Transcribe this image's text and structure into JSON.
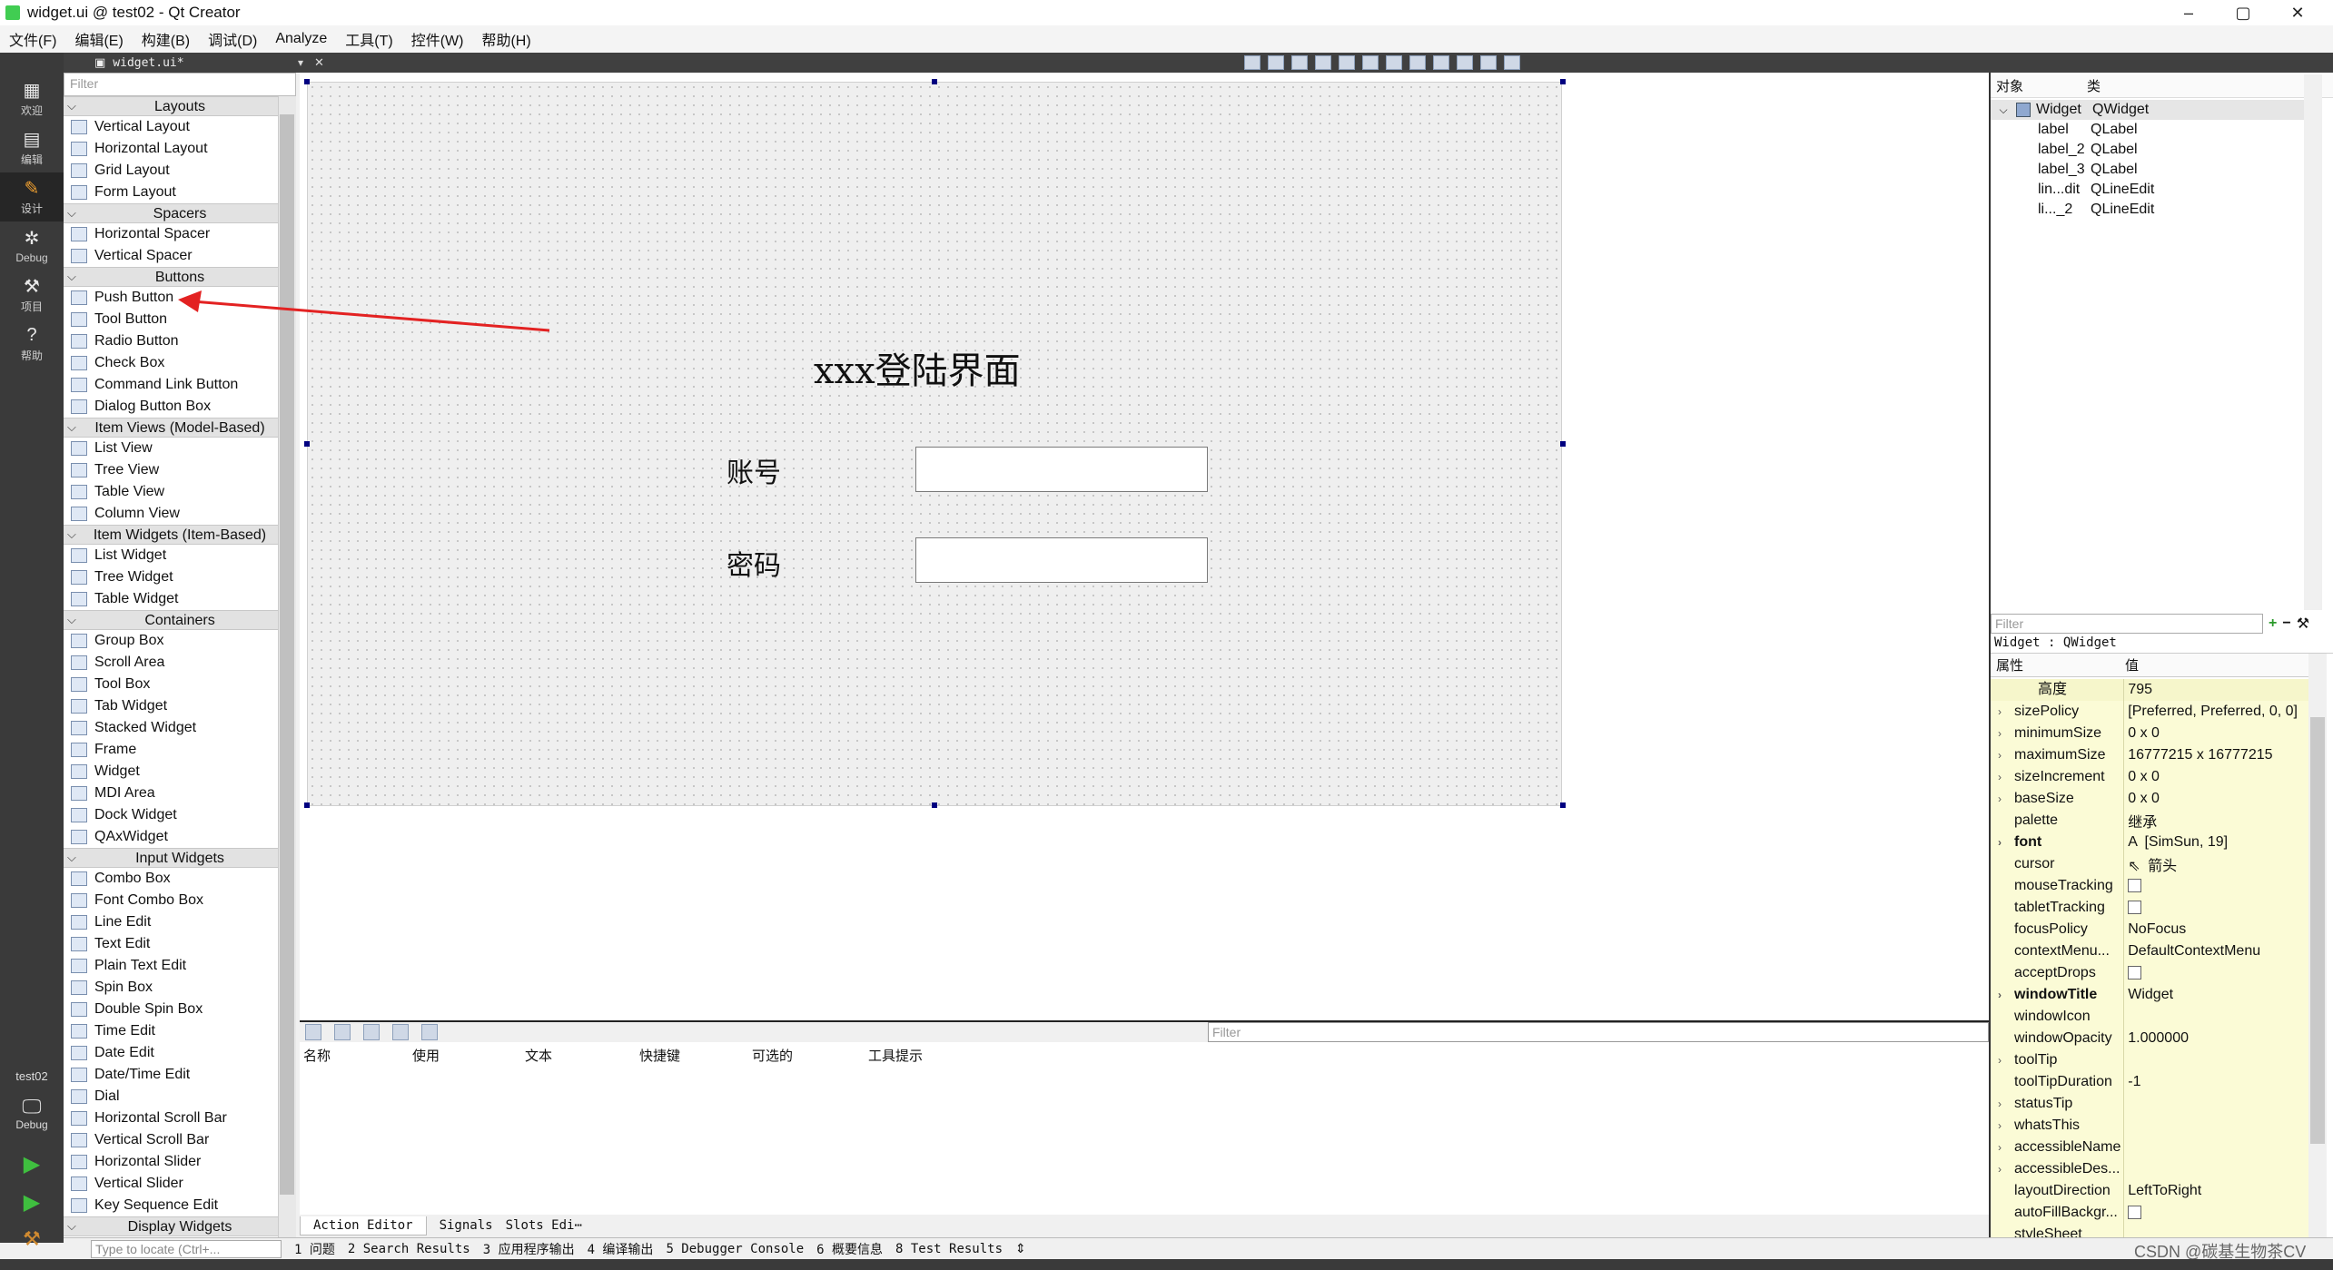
{
  "window": {
    "title": "widget.ui @ test02 - Qt Creator",
    "min": "–",
    "max": "▢",
    "close": "✕"
  },
  "menu": [
    "文件(F)",
    "编辑(E)",
    "构建(B)",
    "调试(D)",
    "Analyze",
    "工具(T)",
    "控件(W)",
    "帮助(H)"
  ],
  "modes": [
    {
      "label": "欢迎",
      "icon": "grid-icon",
      "glyph": "▦"
    },
    {
      "label": "编辑",
      "icon": "edit-icon",
      "glyph": "▤"
    },
    {
      "label": "设计",
      "icon": "design-icon",
      "glyph": "✎"
    },
    {
      "label": "Debug",
      "icon": "bug-icon",
      "glyph": "✲"
    },
    {
      "label": "项目",
      "icon": "wrench-icon",
      "glyph": "⚒"
    },
    {
      "label": "帮助",
      "icon": "help-icon",
      "glyph": "?"
    }
  ],
  "kit": {
    "project": "test02",
    "config": "Debug"
  },
  "editor": {
    "file": "widget.ui*"
  },
  "widgetbox": {
    "filter_placeholder": "Filter",
    "categories": [
      {
        "name": "Layouts",
        "items": [
          "Vertical Layout",
          "Horizontal Layout",
          "Grid Layout",
          "Form Layout"
        ]
      },
      {
        "name": "Spacers",
        "items": [
          "Horizontal Spacer",
          "Vertical Spacer"
        ]
      },
      {
        "name": "Buttons",
        "items": [
          "Push Button",
          "Tool Button",
          "Radio Button",
          "Check Box",
          "Command Link Button",
          "Dialog Button Box"
        ]
      },
      {
        "name": "Item Views (Model-Based)",
        "items": [
          "List View",
          "Tree View",
          "Table View",
          "Column View"
        ]
      },
      {
        "name": "Item Widgets (Item-Based)",
        "items": [
          "List Widget",
          "Tree Widget",
          "Table Widget"
        ]
      },
      {
        "name": "Containers",
        "items": [
          "Group Box",
          "Scroll Area",
          "Tool Box",
          "Tab Widget",
          "Stacked Widget",
          "Frame",
          "Widget",
          "MDI Area",
          "Dock Widget",
          "QAxWidget"
        ]
      },
      {
        "name": "Input Widgets",
        "items": [
          "Combo Box",
          "Font Combo Box",
          "Line Edit",
          "Text Edit",
          "Plain Text Edit",
          "Spin Box",
          "Double Spin Box",
          "Time Edit",
          "Date Edit",
          "Date/Time Edit",
          "Dial",
          "Horizontal Scroll Bar",
          "Vertical Scroll Bar",
          "Horizontal Slider",
          "Vertical Slider",
          "Key Sequence Edit"
        ]
      },
      {
        "name": "Display Widgets",
        "items": []
      }
    ]
  },
  "form": {
    "title": "xxx登陆界面",
    "account_label": "账号",
    "password_label": "密码"
  },
  "action_editor": {
    "filter_placeholder": "Filter",
    "columns": [
      "名称",
      "使用",
      "文本",
      "快捷键",
      "可选的",
      "工具提示"
    ],
    "tabs": [
      "Action Editor",
      "Signals",
      "Slots Edi⋯"
    ]
  },
  "object_inspector": {
    "headers": [
      "对象",
      "类"
    ],
    "rows": [
      {
        "name": "Widget",
        "cls": "QWidget"
      },
      {
        "name": "label",
        "cls": "QLabel"
      },
      {
        "name": "label_2",
        "cls": "QLabel"
      },
      {
        "name": "label_3",
        "cls": "QLabel"
      },
      {
        "name": "lin...dit",
        "cls": "QLineEdit"
      },
      {
        "name": "li..._2",
        "cls": "QLineEdit"
      }
    ]
  },
  "property_editor": {
    "filter_placeholder": "Filter",
    "title": "Widget : QWidget",
    "headers": [
      "属性",
      "值"
    ],
    "rows": [
      {
        "name": "高度",
        "value": "795",
        "sub": true
      },
      {
        "name": "sizePolicy",
        "value": "[Preferred, Preferred, 0, 0]",
        "exp": true
      },
      {
        "name": "minimumSize",
        "value": "0 x 0",
        "exp": true
      },
      {
        "name": "maximumSize",
        "value": "16777215 x 16777215",
        "exp": true
      },
      {
        "name": "sizeIncrement",
        "value": "0 x 0",
        "exp": true
      },
      {
        "name": "baseSize",
        "value": "0 x 0",
        "exp": true
      },
      {
        "name": "palette",
        "value": "继承"
      },
      {
        "name": "font",
        "value": "[SimSun, 19]",
        "exp": true,
        "bold": true,
        "pre": "A"
      },
      {
        "name": "cursor",
        "value": "箭头",
        "pre": "⇖"
      },
      {
        "name": "mouseTracking",
        "value": "",
        "check": true
      },
      {
        "name": "tabletTracking",
        "value": "",
        "check": true
      },
      {
        "name": "focusPolicy",
        "value": "NoFocus"
      },
      {
        "name": "contextMenu...",
        "value": "DefaultContextMenu"
      },
      {
        "name": "acceptDrops",
        "value": "",
        "check": true
      },
      {
        "name": "windowTitle",
        "value": "Widget",
        "exp": true,
        "bold": true
      },
      {
        "name": "windowIcon",
        "value": ""
      },
      {
        "name": "windowOpacity",
        "value": "1.000000"
      },
      {
        "name": "toolTip",
        "value": "",
        "exp": true
      },
      {
        "name": "toolTipDuration",
        "value": "-1"
      },
      {
        "name": "statusTip",
        "value": "",
        "exp": true
      },
      {
        "name": "whatsThis",
        "value": "",
        "exp": true
      },
      {
        "name": "accessibleName",
        "value": "",
        "exp": true
      },
      {
        "name": "accessibleDes...",
        "value": "",
        "exp": true
      },
      {
        "name": "layoutDirection",
        "value": "LeftToRight"
      },
      {
        "name": "autoFillBackgr...",
        "value": "",
        "check": true
      },
      {
        "name": "styleSheet",
        "value": ""
      }
    ]
  },
  "statusbar": {
    "locate_placeholder": "Type to locate (Ctrl+...",
    "items": [
      "1 问题",
      "2 Search Results",
      "3 应用程序输出",
      "4 编译输出",
      "5 Debugger Console",
      "6 概要信息",
      "8 Test Results",
      "⇕"
    ],
    "watermark": "CSDN @碳基生物茶CV"
  }
}
